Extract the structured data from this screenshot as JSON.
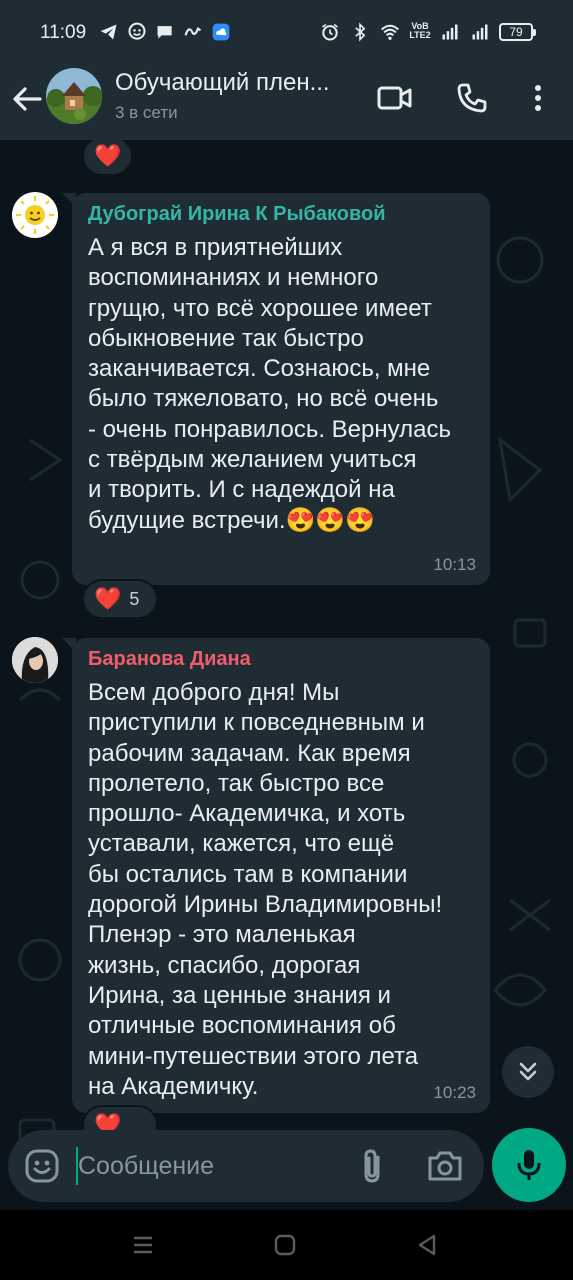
{
  "status_bar": {
    "time": "11:09",
    "left_icons": [
      "telegram-icon",
      "chat-bubble-icon",
      "message-icon",
      "vpn-icon",
      "app-icon"
    ],
    "right_icons": [
      "alarm-icon",
      "bluetooth-icon",
      "wifi-icon",
      "volte-icon",
      "signal-icon",
      "signal-icon",
      "battery-icon"
    ],
    "volte_top": "VoB",
    "volte_bottom": "LTE2",
    "battery": "79"
  },
  "header": {
    "title": "Обучающий плен...",
    "subtitle": "3 в сети",
    "buttons": [
      "back-arrow-icon",
      "video-call-icon",
      "voice-call-icon",
      "more-vertical-icon"
    ]
  },
  "messages": [
    {
      "sender": "Дубограй Ирина К Рыбаковой",
      "sender_color": "#35b6a5",
      "text": "А я вся в приятнейших\nвоспоминаниях и немного\nгрущю, что всё хорошее имеет\nобыкновение так быстро\nзаканчивается. Сознаюсь, мне\nбыло тяжеловато, но всё очень\n- очень понравилось. Вернулась\nс твёрдым желанием учиться\nи творить. И с надеждой на\nбудущие встречи.😍😍😍",
      "time": "10:13",
      "reaction": "❤️",
      "reaction_count": "5"
    },
    {
      "sender": "Баранова Диана",
      "sender_color": "#f15c6d",
      "text": "Всем доброго дня! Мы\nприступили к повседневным и\nрабочим задачам. Как время\nпролетело, так быстро все\nпрошло- Академичка, и хоть\nуставали, кажется, что ещё\nбы остались там в компании\nдорогой Ирины Владимировны!\nПленэр - это маленькая\nжизнь, спасибо, дорогая\nИрина, за ценные знания и\nотличные воспоминания об\nмини-путешествии этого лета\nна Академичку.",
      "time": "10:23",
      "reaction": "❤️"
    }
  ],
  "top_reaction": "❤️",
  "input": {
    "placeholder": "Сообщение"
  },
  "colors": {
    "background": "#0b141a",
    "bubble": "#202c33",
    "bar": "#1f2c34",
    "accent": "#00a884"
  }
}
